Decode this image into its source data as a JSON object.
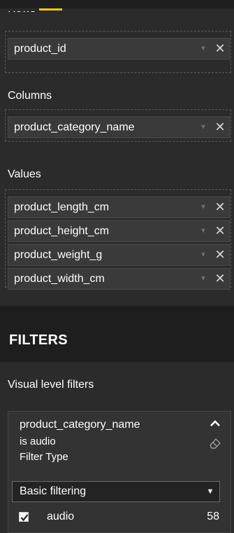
{
  "wells": {
    "rows": {
      "label": "Rows",
      "fields": [
        "product_id"
      ]
    },
    "columns": {
      "label": "Columns",
      "fields": [
        "product_category_name"
      ]
    },
    "values": {
      "label": "Values",
      "fields": [
        "product_length_cm",
        "product_height_cm",
        "product_weight_g",
        "product_width_cm"
      ]
    }
  },
  "filters": {
    "title": "FILTERS",
    "visual_level_label": "Visual level filters",
    "card": {
      "field_name": "product_category_name",
      "summary": "is audio",
      "filter_type_label": "Filter Type",
      "filter_type_value": "Basic filtering",
      "options": [
        {
          "label": "audio",
          "count": "58",
          "checked": true
        }
      ]
    }
  },
  "icons": {
    "remove": "close-icon",
    "dropdown": "chevron-down-icon",
    "collapse": "chevron-up-icon",
    "clear": "eraser-icon",
    "check": "checkmark-icon"
  },
  "colors": {
    "accent": "#f2c811",
    "panel": "#2b2b2b",
    "field": "#3a3a3a",
    "header": "#1e1e1e"
  }
}
